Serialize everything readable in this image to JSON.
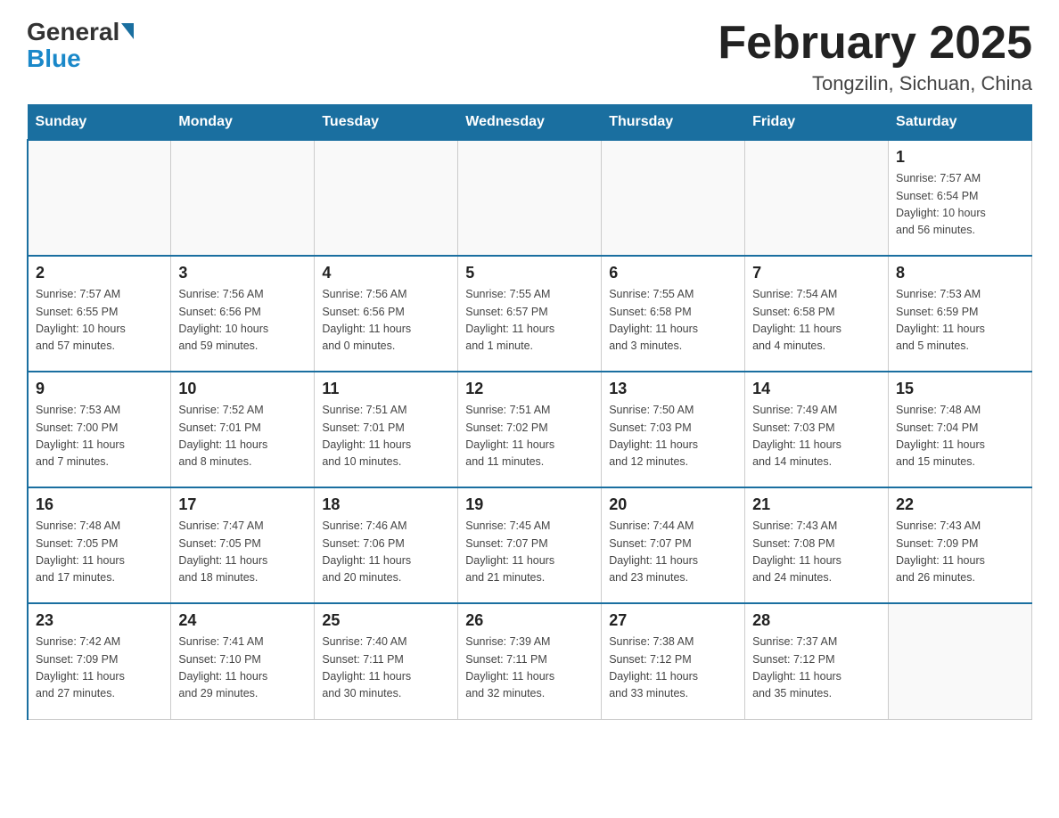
{
  "header": {
    "logo_general": "General",
    "logo_blue": "Blue",
    "title": "February 2025",
    "subtitle": "Tongzilin, Sichuan, China"
  },
  "days_of_week": [
    "Sunday",
    "Monday",
    "Tuesday",
    "Wednesday",
    "Thursday",
    "Friday",
    "Saturday"
  ],
  "weeks": [
    [
      {
        "day": "",
        "info": ""
      },
      {
        "day": "",
        "info": ""
      },
      {
        "day": "",
        "info": ""
      },
      {
        "day": "",
        "info": ""
      },
      {
        "day": "",
        "info": ""
      },
      {
        "day": "",
        "info": ""
      },
      {
        "day": "1",
        "info": "Sunrise: 7:57 AM\nSunset: 6:54 PM\nDaylight: 10 hours\nand 56 minutes."
      }
    ],
    [
      {
        "day": "2",
        "info": "Sunrise: 7:57 AM\nSunset: 6:55 PM\nDaylight: 10 hours\nand 57 minutes."
      },
      {
        "day": "3",
        "info": "Sunrise: 7:56 AM\nSunset: 6:56 PM\nDaylight: 10 hours\nand 59 minutes."
      },
      {
        "day": "4",
        "info": "Sunrise: 7:56 AM\nSunset: 6:56 PM\nDaylight: 11 hours\nand 0 minutes."
      },
      {
        "day": "5",
        "info": "Sunrise: 7:55 AM\nSunset: 6:57 PM\nDaylight: 11 hours\nand 1 minute."
      },
      {
        "day": "6",
        "info": "Sunrise: 7:55 AM\nSunset: 6:58 PM\nDaylight: 11 hours\nand 3 minutes."
      },
      {
        "day": "7",
        "info": "Sunrise: 7:54 AM\nSunset: 6:58 PM\nDaylight: 11 hours\nand 4 minutes."
      },
      {
        "day": "8",
        "info": "Sunrise: 7:53 AM\nSunset: 6:59 PM\nDaylight: 11 hours\nand 5 minutes."
      }
    ],
    [
      {
        "day": "9",
        "info": "Sunrise: 7:53 AM\nSunset: 7:00 PM\nDaylight: 11 hours\nand 7 minutes."
      },
      {
        "day": "10",
        "info": "Sunrise: 7:52 AM\nSunset: 7:01 PM\nDaylight: 11 hours\nand 8 minutes."
      },
      {
        "day": "11",
        "info": "Sunrise: 7:51 AM\nSunset: 7:01 PM\nDaylight: 11 hours\nand 10 minutes."
      },
      {
        "day": "12",
        "info": "Sunrise: 7:51 AM\nSunset: 7:02 PM\nDaylight: 11 hours\nand 11 minutes."
      },
      {
        "day": "13",
        "info": "Sunrise: 7:50 AM\nSunset: 7:03 PM\nDaylight: 11 hours\nand 12 minutes."
      },
      {
        "day": "14",
        "info": "Sunrise: 7:49 AM\nSunset: 7:03 PM\nDaylight: 11 hours\nand 14 minutes."
      },
      {
        "day": "15",
        "info": "Sunrise: 7:48 AM\nSunset: 7:04 PM\nDaylight: 11 hours\nand 15 minutes."
      }
    ],
    [
      {
        "day": "16",
        "info": "Sunrise: 7:48 AM\nSunset: 7:05 PM\nDaylight: 11 hours\nand 17 minutes."
      },
      {
        "day": "17",
        "info": "Sunrise: 7:47 AM\nSunset: 7:05 PM\nDaylight: 11 hours\nand 18 minutes."
      },
      {
        "day": "18",
        "info": "Sunrise: 7:46 AM\nSunset: 7:06 PM\nDaylight: 11 hours\nand 20 minutes."
      },
      {
        "day": "19",
        "info": "Sunrise: 7:45 AM\nSunset: 7:07 PM\nDaylight: 11 hours\nand 21 minutes."
      },
      {
        "day": "20",
        "info": "Sunrise: 7:44 AM\nSunset: 7:07 PM\nDaylight: 11 hours\nand 23 minutes."
      },
      {
        "day": "21",
        "info": "Sunrise: 7:43 AM\nSunset: 7:08 PM\nDaylight: 11 hours\nand 24 minutes."
      },
      {
        "day": "22",
        "info": "Sunrise: 7:43 AM\nSunset: 7:09 PM\nDaylight: 11 hours\nand 26 minutes."
      }
    ],
    [
      {
        "day": "23",
        "info": "Sunrise: 7:42 AM\nSunset: 7:09 PM\nDaylight: 11 hours\nand 27 minutes."
      },
      {
        "day": "24",
        "info": "Sunrise: 7:41 AM\nSunset: 7:10 PM\nDaylight: 11 hours\nand 29 minutes."
      },
      {
        "day": "25",
        "info": "Sunrise: 7:40 AM\nSunset: 7:11 PM\nDaylight: 11 hours\nand 30 minutes."
      },
      {
        "day": "26",
        "info": "Sunrise: 7:39 AM\nSunset: 7:11 PM\nDaylight: 11 hours\nand 32 minutes."
      },
      {
        "day": "27",
        "info": "Sunrise: 7:38 AM\nSunset: 7:12 PM\nDaylight: 11 hours\nand 33 minutes."
      },
      {
        "day": "28",
        "info": "Sunrise: 7:37 AM\nSunset: 7:12 PM\nDaylight: 11 hours\nand 35 minutes."
      },
      {
        "day": "",
        "info": ""
      }
    ]
  ]
}
